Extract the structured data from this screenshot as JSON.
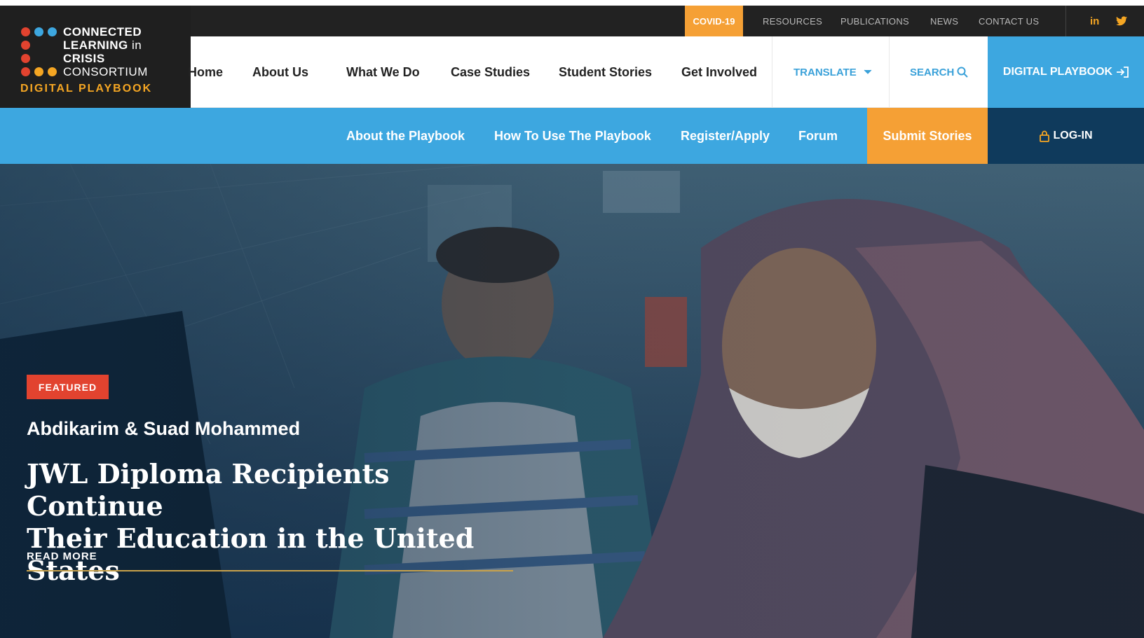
{
  "logo": {
    "brand_line1": "CONNECTED",
    "brand_line2_bold": "LEARNING",
    "brand_line2_light": " in",
    "brand_line3": "CRISIS",
    "brand_line4": "CONSORTIUM",
    "subtitle": "DIGITAL PLAYBOOK"
  },
  "utility": {
    "covid": "COVID-19",
    "links": [
      "RESOURCES",
      "PUBLICATIONS",
      "NEWS",
      "CONTACT US"
    ],
    "social": [
      "linkedin-icon",
      "twitter-icon"
    ]
  },
  "mainnav": {
    "links": [
      "Home",
      "About Us",
      "What We Do",
      "Case Studies",
      "Student Stories",
      "Get Involved"
    ],
    "translate": "TRANSLATE",
    "search": "SEARCH",
    "playbook": "DIGITAL PLAYBOOK"
  },
  "subnav": {
    "links": [
      "About the Playbook",
      "How To Use The Playbook",
      "Register/Apply",
      "Forum"
    ],
    "submit": "Submit Stories",
    "login": "LOG-IN"
  },
  "hero": {
    "badge": "FEATURED",
    "names": "Abdikarim & Suad Mohammed",
    "headline_line1": "JWL Diploma Recipients Continue",
    "headline_line2": "Their Education in the United States",
    "read_more": "READ MORE"
  },
  "colors": {
    "accent_orange": "#f5a035",
    "accent_blue": "#3da7e0",
    "navy": "#0f3a5c",
    "badge_red": "#e2432f",
    "dark": "#222222"
  }
}
